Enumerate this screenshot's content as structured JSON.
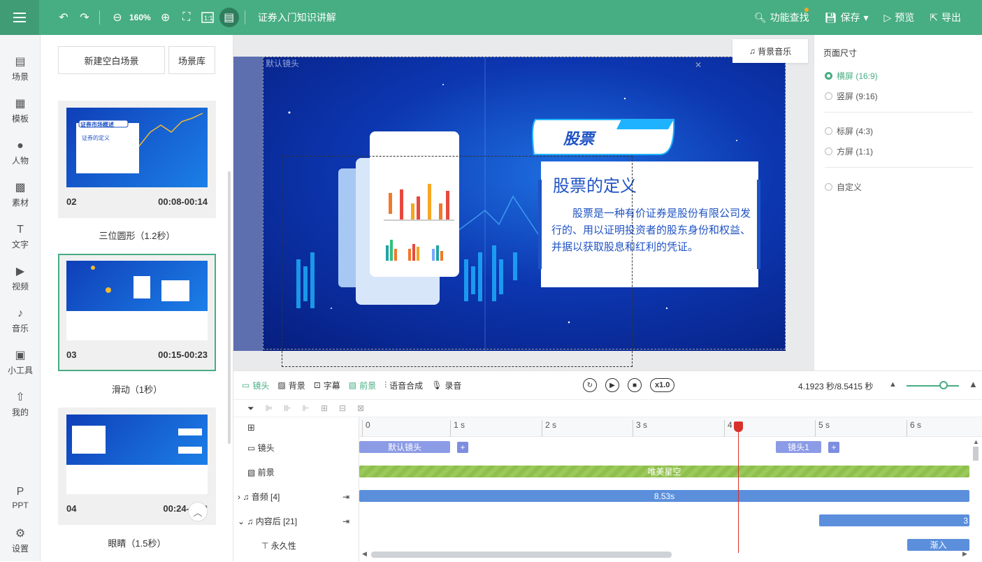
{
  "header": {
    "title": "证券入门知识讲解",
    "zoom": "160%",
    "actions": [
      {
        "label": "功能查找",
        "icon": "search-icon"
      },
      {
        "label": "保存",
        "icon": "save-icon"
      },
      {
        "label": "预览",
        "icon": "preview-icon"
      },
      {
        "label": "导出",
        "icon": "export-icon"
      }
    ]
  },
  "nav": [
    {
      "label": "场景",
      "icon": "scene-icon"
    },
    {
      "label": "模板",
      "icon": "template-icon"
    },
    {
      "label": "人物",
      "icon": "person-icon"
    },
    {
      "label": "素材",
      "icon": "material-icon"
    },
    {
      "label": "文字",
      "icon": "text-icon"
    },
    {
      "label": "视频",
      "icon": "video-icon"
    },
    {
      "label": "音乐",
      "icon": "music-icon"
    },
    {
      "label": "小工具",
      "icon": "toolbox-icon"
    },
    {
      "label": "我的",
      "icon": "upload-icon"
    },
    {
      "label": "PPT",
      "icon": "ppt-icon"
    },
    {
      "label": "设置",
      "icon": "settings-icon"
    }
  ],
  "scenes": {
    "new_button": "新建空白场景",
    "library_button": "场景库",
    "cards": [
      {
        "num": "02",
        "time": "00:08-00:14",
        "thumb_title": "证券市场概述",
        "thumb_sub": "证券的定义"
      },
      {
        "num": "03",
        "time": "00:15-00:23"
      },
      {
        "num": "04",
        "time": "00:24-00:3"
      }
    ],
    "transitions": [
      "三位圆形（1.2秒）",
      "滑动（1秒）",
      "眼睛（1.5秒）"
    ]
  },
  "canvas": {
    "bg_music": "背景音乐",
    "camera_label": "默认镜头",
    "badge": "股票",
    "card_title": "股票的定义",
    "card_body": "股票是一种有价证券是股份有限公司发行的、用以证明投资者的股东身份和权益、并据以获取股息和红利的凭证。"
  },
  "page_size": {
    "title": "页面尺寸",
    "options": [
      "横屏 (16:9)",
      "竖屏 (9:16)",
      "标屏 (4:3)",
      "方屏 (1:1)",
      "自定义"
    ],
    "selected": 0
  },
  "timeline": {
    "tabs": [
      "镜头",
      "背景",
      "字幕",
      "前景",
      "语音合成",
      "录音"
    ],
    "speed": "x1.0",
    "time": "4.1923 秒/8.5415 秒",
    "ticks": [
      "0",
      "1 s",
      "2 s",
      "3 s",
      "4 s",
      "5 s",
      "6 s"
    ],
    "playhead_seconds": 4.19,
    "tracks": [
      {
        "label": "镜头",
        "icon": "camera-icon"
      },
      {
        "label": "前景",
        "icon": "foreground-icon"
      },
      {
        "label": "音频 [4]",
        "icon": "audio-icon"
      },
      {
        "label": "内容后 [21]",
        "icon": "content-icon"
      },
      {
        "label": "永久性",
        "icon": "text-icon"
      }
    ],
    "blocks": {
      "camera_default": "默认镜头",
      "camera_1": "镜头1",
      "foreground": "唯美星空",
      "audio": "8.53s",
      "content": "3",
      "fade": "渐入"
    }
  },
  "colors": {
    "accent": "#47ad82",
    "block_blue": "#5b8fdc",
    "block_green": "#8fbf4d",
    "camera_block": "#8c9be6"
  }
}
